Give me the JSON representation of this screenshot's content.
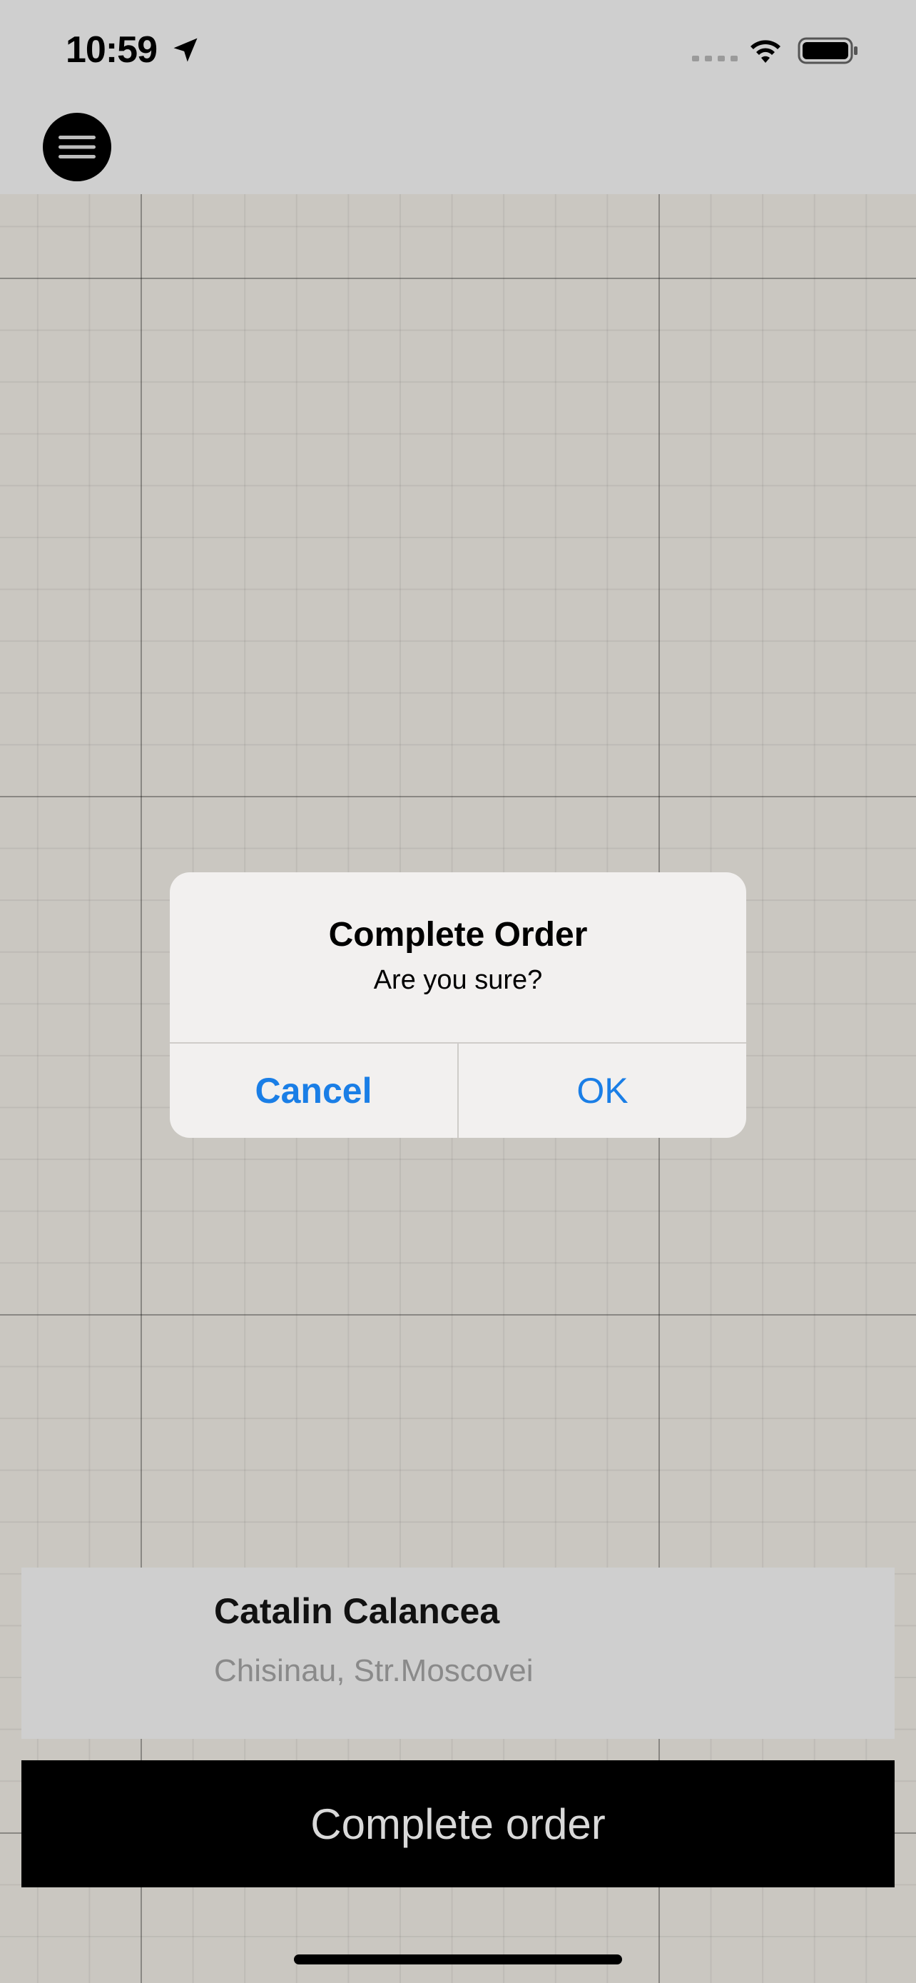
{
  "status_bar": {
    "time": "10:59",
    "icons": [
      "location-arrow-icon",
      "cellular-signal-icon",
      "wifi-icon",
      "battery-icon"
    ]
  },
  "header": {
    "menu_icon": "hamburger-menu-icon"
  },
  "alert": {
    "title": "Complete Order",
    "message": "Are you sure?",
    "cancel_label": "Cancel",
    "ok_label": "OK"
  },
  "order": {
    "customer_name": "Catalin Calancea",
    "address": "Chisinau, Str.Moscovei",
    "complete_button_label": "Complete order"
  },
  "colors": {
    "accent": "#1a7ee6",
    "button_bg": "#000000",
    "map_bg": "#cac7c1"
  }
}
